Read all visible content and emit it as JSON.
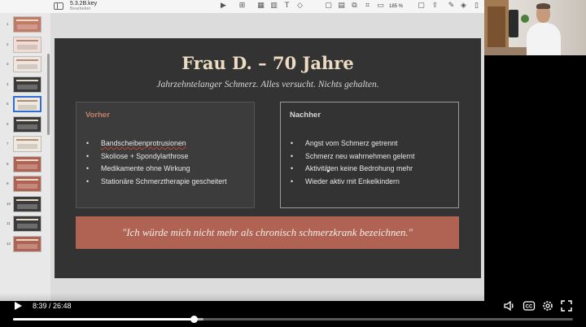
{
  "editor": {
    "doc_title": "5.3.2B.key",
    "doc_subtitle": "Bearbeitet",
    "zoom": "185 %"
  },
  "sidebar": {
    "slides": [
      {
        "num": "1",
        "accent": "#c07a66"
      },
      {
        "num": "2",
        "accent": "#f2ddd6"
      },
      {
        "num": "3",
        "accent": "#f0e6de"
      },
      {
        "num": "4",
        "accent": "#3a3a3a"
      },
      {
        "num": "5",
        "accent": "#efe9dd"
      },
      {
        "num": "6",
        "accent": "#3b3b3b"
      },
      {
        "num": "7",
        "accent": "#efe9dd"
      },
      {
        "num": "8",
        "accent": "#b06353"
      },
      {
        "num": "9",
        "accent": "#b06353"
      },
      {
        "num": "10",
        "accent": "#3b3b3b"
      },
      {
        "num": "11",
        "accent": "#3b3b3b"
      },
      {
        "num": "12",
        "accent": "#b06353"
      }
    ],
    "selected_index": 4
  },
  "slide": {
    "title": "Frau D. – 70 Jahre",
    "subtitle": "Jahrzehntelanger Schmerz. Alles versucht. Nichts gehalten.",
    "before": {
      "heading": "Vorher",
      "items": [
        "Bandscheibenprotrusionen",
        "Skoliose + Spondylarthrose",
        "Medikamente ohne Wirkung",
        "Stationäre Schmerztherapie gescheitert"
      ]
    },
    "after": {
      "heading": "Nachher",
      "items": [
        "Angst vom Schmerz getrennt",
        "Schmerz neu wahrnehmen gelernt",
        "Aktivitäten keine Bedrohung mehr",
        "Wieder aktiv mit Enkelkindern"
      ]
    },
    "quote": "\"Ich würde mich nicht mehr als chronisch schmerzkrank bezeichnen.\""
  },
  "player": {
    "current_time": "8:39",
    "duration": "26:48",
    "time_display": "8:39 / 26:48",
    "progress_fraction": 0.323,
    "buffer_fraction": 0.34,
    "play_icon": "play-icon",
    "controls": [
      "volume-icon",
      "captions-icon",
      "settings-icon",
      "fullscreen-icon"
    ]
  },
  "colors": {
    "slide_bg": "#333333",
    "title_color": "#ecdcc2",
    "accent": "#c87f6c",
    "quote_bg": "#b06353"
  }
}
